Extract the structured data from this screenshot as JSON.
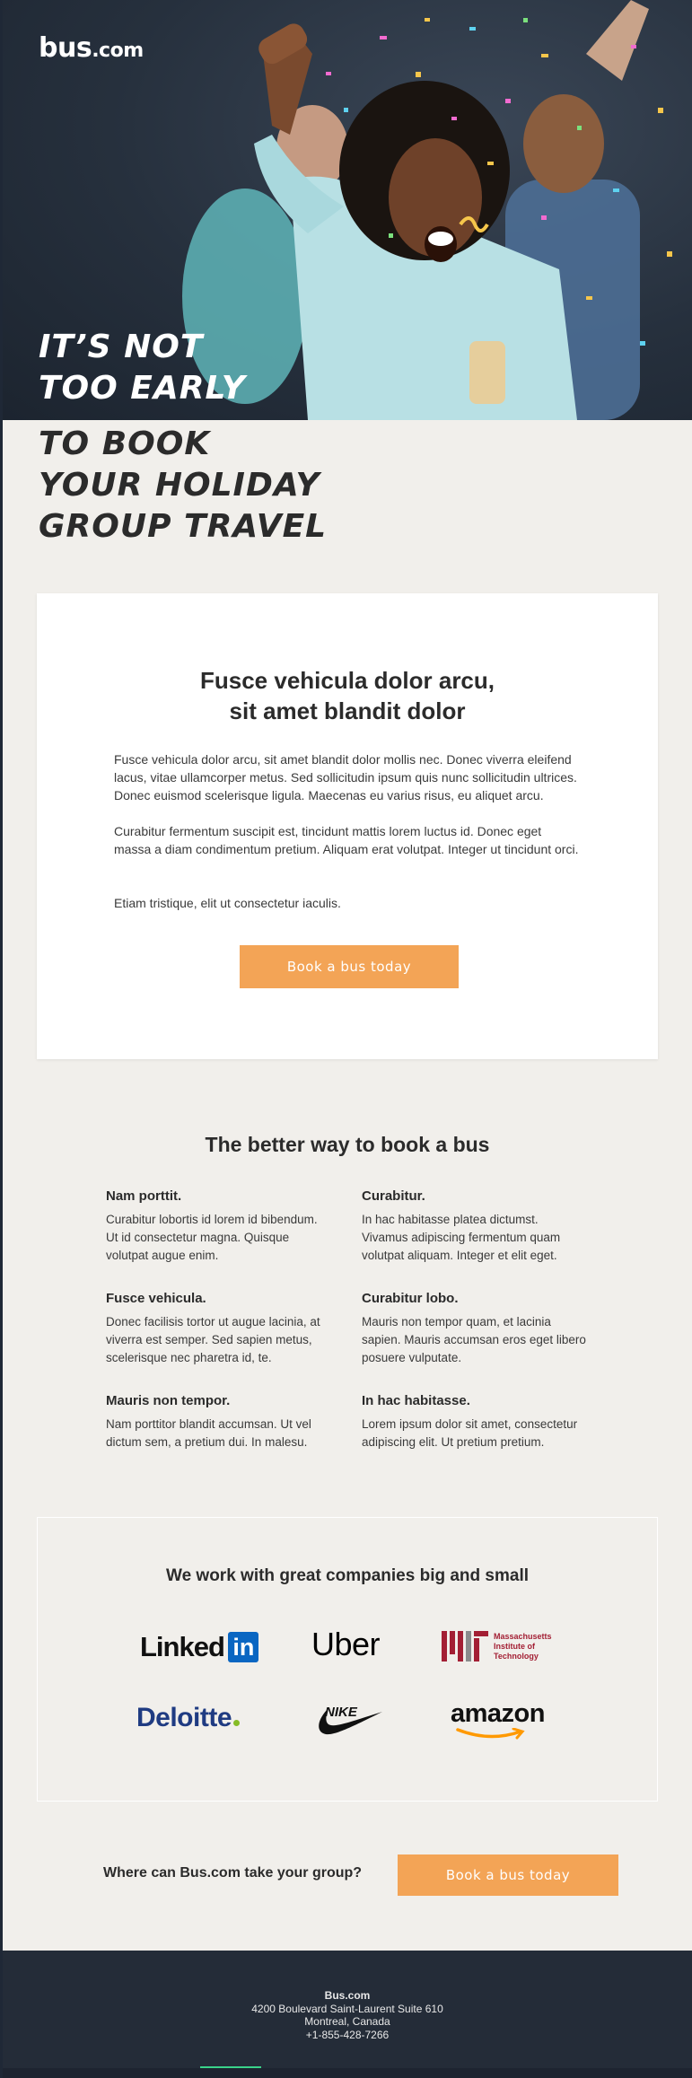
{
  "brand": {
    "logo_main": "bus",
    "logo_tld": ".com"
  },
  "hero": {
    "headline_light": [
      "IT’S NOT",
      "TOO EARLY"
    ],
    "headline_dark": [
      "TO BOOK",
      "YOUR HOLIDAY",
      "GROUP TRAVEL"
    ]
  },
  "intro": {
    "title_line1": "Fusce vehicula dolor arcu,",
    "title_line2": "sit amet blandit dolor",
    "paragraphs": [
      "Fusce vehicula dolor arcu, sit amet blandit dolor mollis nec. Donec viverra eleifend lacus, vitae ullamcorper metus. Sed sollicitudin ipsum quis nunc sollicitudin ultrices. Donec euismod scelerisque ligula. Maecenas eu varius risus, eu aliquet arcu.",
      "Curabitur fermentum suscipit est, tincidunt mattis lorem luctus id. Donec eget massa a diam condimentum pretium. Aliquam erat volutpat. Integer ut tincidunt orci.",
      "Etiam tristique, elit ut consectetur iaculis."
    ],
    "button_label": "Book a bus today"
  },
  "features": {
    "title": "The better way to book a bus",
    "items": [
      {
        "heading": "Nam porttit.",
        "body": "Curabitur lobortis id lorem id bibendum. Ut id consectetur magna. Quisque volutpat augue enim."
      },
      {
        "heading": "Curabitur.",
        "body": "In hac habitasse platea dictumst. Vivamus adipiscing fermentum quam volutpat aliquam. Integer et elit eget."
      },
      {
        "heading": "Fusce vehicula.",
        "body": "Donec facilisis tortor ut augue lacinia, at viverra est semper. Sed sapien metus, scelerisque nec pharetra id, te."
      },
      {
        "heading": "Curabitur lobo.",
        "body": "Mauris non tempor quam, et lacinia sapien. Mauris accumsan eros eget libero posuere vulputate."
      },
      {
        "heading": "Mauris non tempor.",
        "body": "Nam porttitor blandit accumsan. Ut vel dictum sem, a pretium dui. In malesu."
      },
      {
        "heading": "In hac habitasse.",
        "body": "Lorem ipsum dolor sit amet, consectetur adipiscing elit. Ut pretium pretium."
      }
    ]
  },
  "partners": {
    "title": "We work with great companies big and small",
    "logos": {
      "linkedin_text": "Linked",
      "linkedin_in": "in",
      "uber": "Uber",
      "mit_line1": "Massachusetts",
      "mit_line2": "Institute of",
      "mit_line3": "Technology",
      "deloitte": "Deloitte",
      "nike": "NIKE",
      "amazon": "amazon"
    }
  },
  "cta": {
    "text": "Where can Bus.com take your group?",
    "button_label": "Book a bus today"
  },
  "footer": {
    "company": "Bus.com",
    "address": "4200 Boulevard Saint-Laurent Suite 610",
    "city": "Montreal, Canada",
    "phone": "+1-855-428-7266"
  },
  "colors": {
    "accent": "#f3a456",
    "background": "#f1efeb",
    "footer": "#242c38",
    "footer_accent": "#3ad38a"
  }
}
